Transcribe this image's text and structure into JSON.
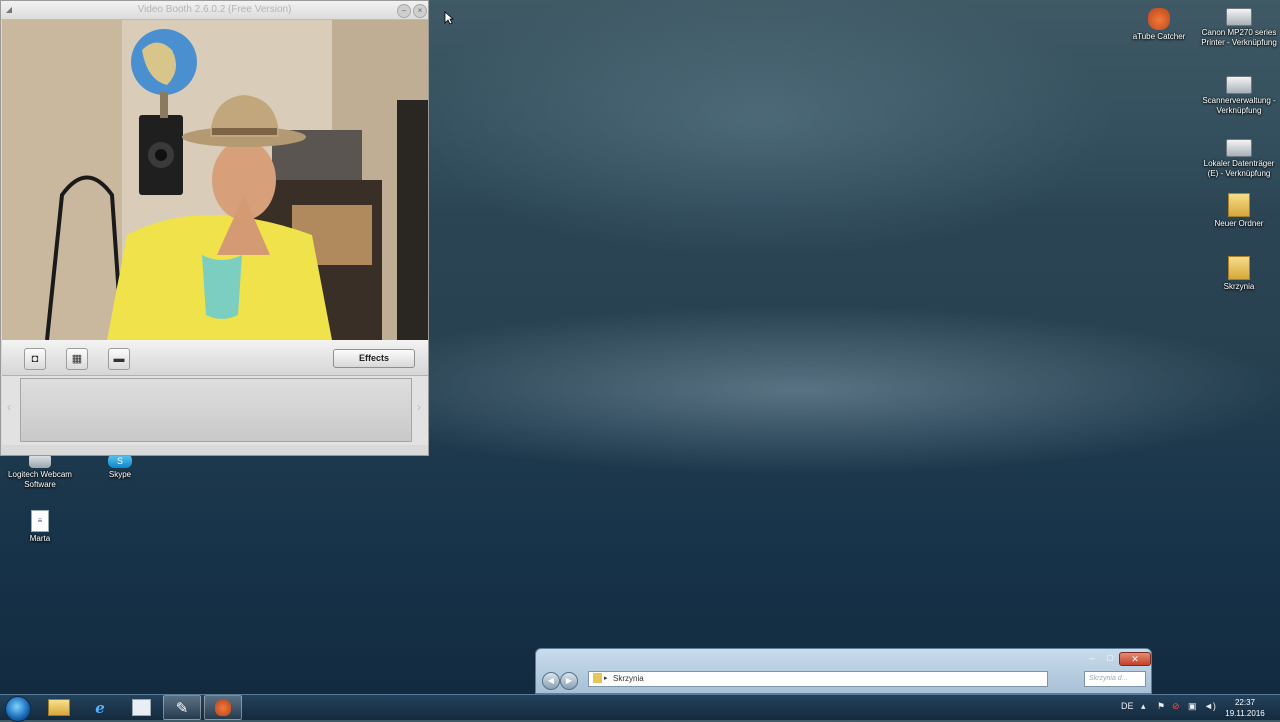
{
  "video_booth": {
    "title": "Video Booth 2.6.0.2 (Free Version)",
    "controls": {
      "minimize": "–",
      "close": "×"
    },
    "toolbar": {
      "photo_icon": "camera-icon",
      "multi_icon": "grid-icon",
      "video_icon": "film-icon",
      "effects_label": "Effects"
    },
    "strip": {
      "prev": "‹",
      "next": "›"
    }
  },
  "desktop_icons": {
    "atube": "aTube Catcher",
    "canon": "Canon MP270 series Printer - Verknüpfung",
    "scanner": "Scannerverwaltung - Verknüpfung",
    "lokal": "Lokaler Datenträger (E) - Verknüpfung",
    "neuer": "Neuer Ordner",
    "skrzynia": "Skrzynia",
    "logitech": "Logitech Webcam Software",
    "skype": "Skype",
    "marta": "Marta"
  },
  "explorer": {
    "address": "Skrzynia",
    "search_placeholder": "Skrzynia d...",
    "controls": {
      "minimize": "–",
      "maximize": "□",
      "close": "✕"
    }
  },
  "taskbar": {
    "language": "DE",
    "time": "22:37",
    "date": "19.11.2016"
  },
  "colors": {
    "taskbar": "#1b3650",
    "desktop": "#2b4555",
    "explorer_frame": "#b6cde0"
  }
}
